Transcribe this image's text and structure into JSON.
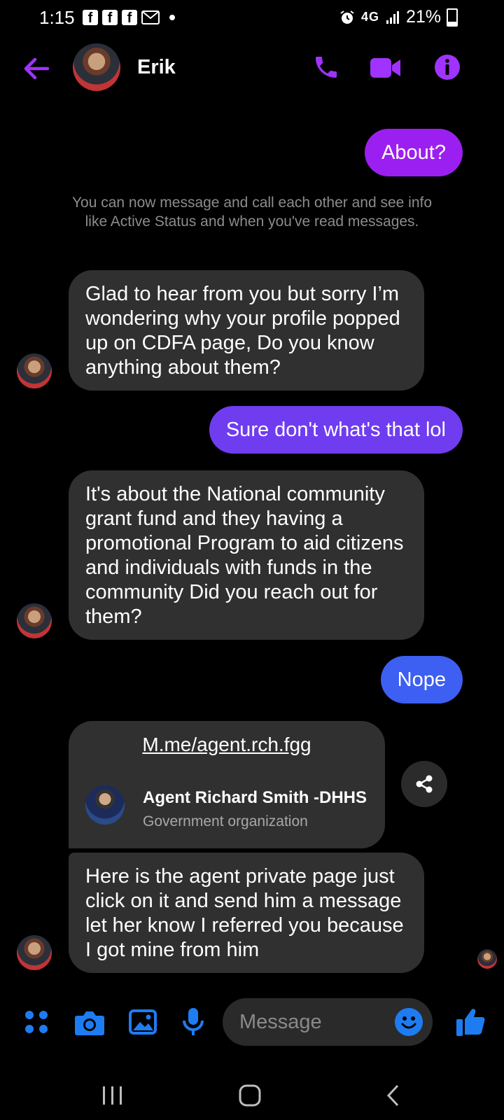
{
  "status_bar": {
    "time": "1:15",
    "network": "4G",
    "battery": "21%",
    "battery_level": 0.21
  },
  "header": {
    "contact_name": "Erik",
    "icons": [
      "back-arrow-icon",
      "phone-icon",
      "video-icon",
      "info-icon"
    ]
  },
  "messages": {
    "m1": "About?",
    "system": "You can now message and call each other and see info like Active Status and when you've read messages.",
    "m2": "Glad to hear from you but sorry I’m wondering why your profile popped up on CDFA page, Do you know anything about them?",
    "m3": "Sure don't what's that lol",
    "m4": "It's about the National community grant fund and they having a promotional Program to aid citizens and individuals with funds in the community Did you reach out  for them?",
    "m5": "Nope",
    "link": {
      "url": "M.me/agent.rch.fgg",
      "page_name": "Agent Richard Smith -DHHS",
      "page_category": "Government organization"
    },
    "m6": "Here is the agent private page just click on it and send him a message let her know I referred you because I got mine from him"
  },
  "composer": {
    "placeholder": "Message"
  },
  "colors": {
    "accent_purple": "#a033ff",
    "bubble_purple": "#9b1ff0",
    "bubble_violet": "#6f3cf0",
    "bubble_blue": "#3d5ff2",
    "incoming_bubble": "#303030",
    "composer_blue": "#1e7cf2"
  }
}
